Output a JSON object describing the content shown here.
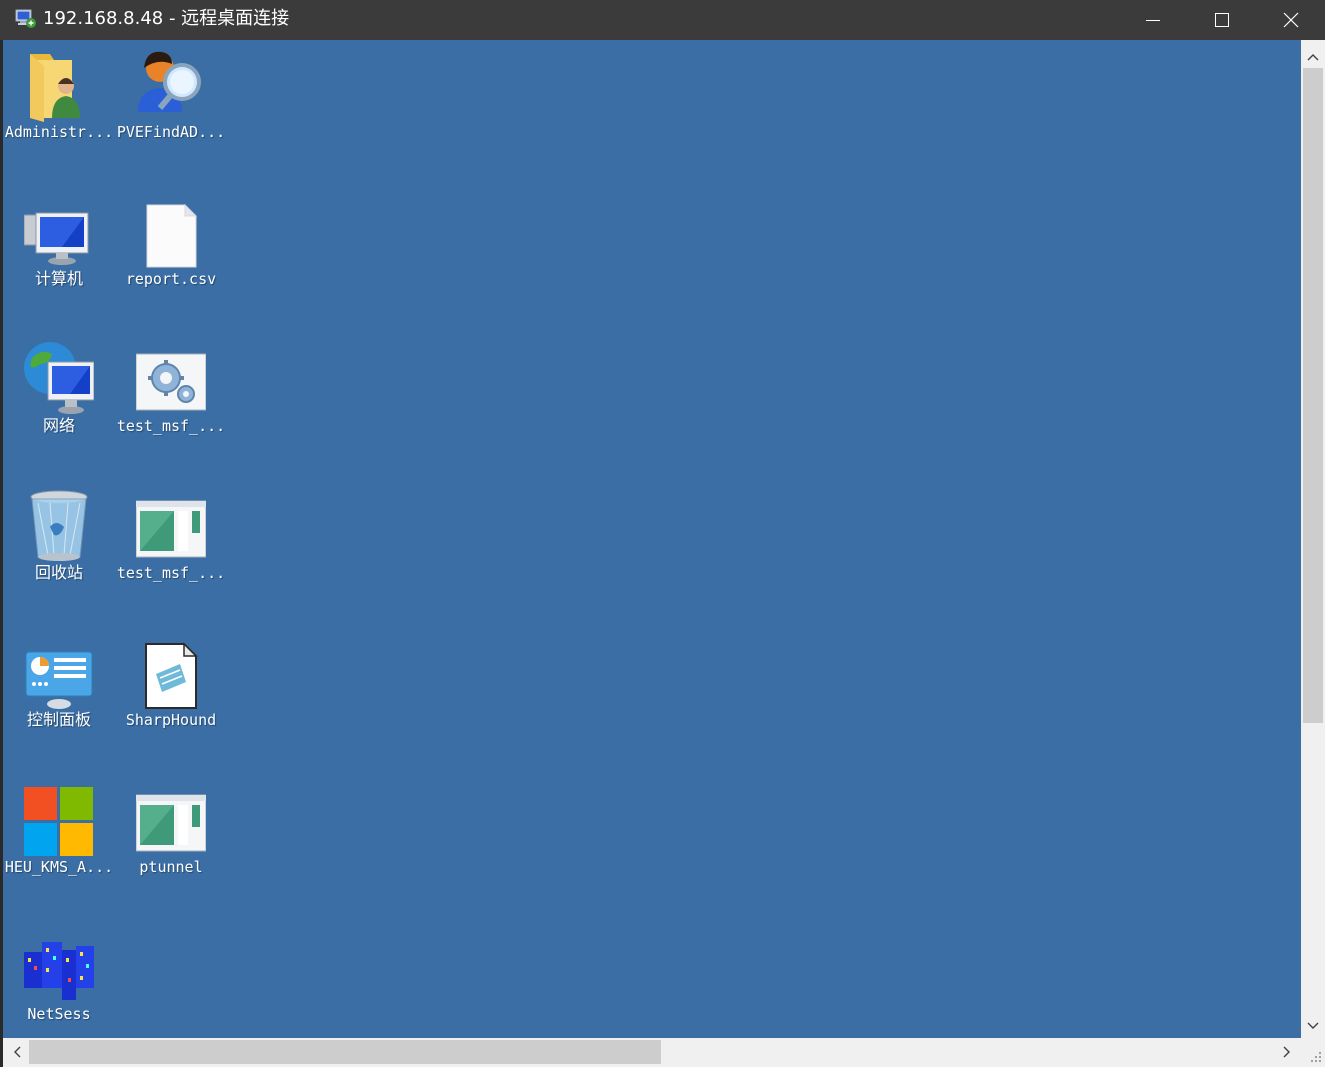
{
  "window": {
    "title": "192.168.8.48 - 远程桌面连接",
    "titlebar_color": "#3b3b3b",
    "controls": [
      "minimize-icon",
      "maximize-icon",
      "close-icon"
    ]
  },
  "desktop": {
    "background_color": "#3a6ea5",
    "icons": [
      {
        "label": "Administr...",
        "icon": "user-folder-icon"
      },
      {
        "label": "PVEFindAD...",
        "icon": "user-search-icon"
      },
      {
        "label": "计算机",
        "icon": "computer-icon"
      },
      {
        "label": "report.csv",
        "icon": "blank-file-icon"
      },
      {
        "label": "网络",
        "icon": "network-globe-icon"
      },
      {
        "label": "test_msf_...",
        "icon": "gear-settings-icon"
      },
      {
        "label": "回收站",
        "icon": "recycle-bin-icon"
      },
      {
        "label": "test_msf_...",
        "icon": "application-window-icon"
      },
      {
        "label": "控制面板",
        "icon": "control-panel-icon"
      },
      {
        "label": "SharpHound",
        "icon": "text-document-icon"
      },
      {
        "label": "HEU_KMS_A...",
        "icon": "windows-logo-icon"
      },
      {
        "label": "ptunnel",
        "icon": "application-window-icon"
      },
      {
        "label": "NetSess",
        "icon": "city-buildings-icon"
      }
    ]
  },
  "scrollbars": {
    "vertical": {
      "position_fraction": 0.0,
      "visible_fraction": 0.67
    },
    "horizontal": {
      "position_fraction": 0.0,
      "visible_fraction": 0.51
    }
  }
}
